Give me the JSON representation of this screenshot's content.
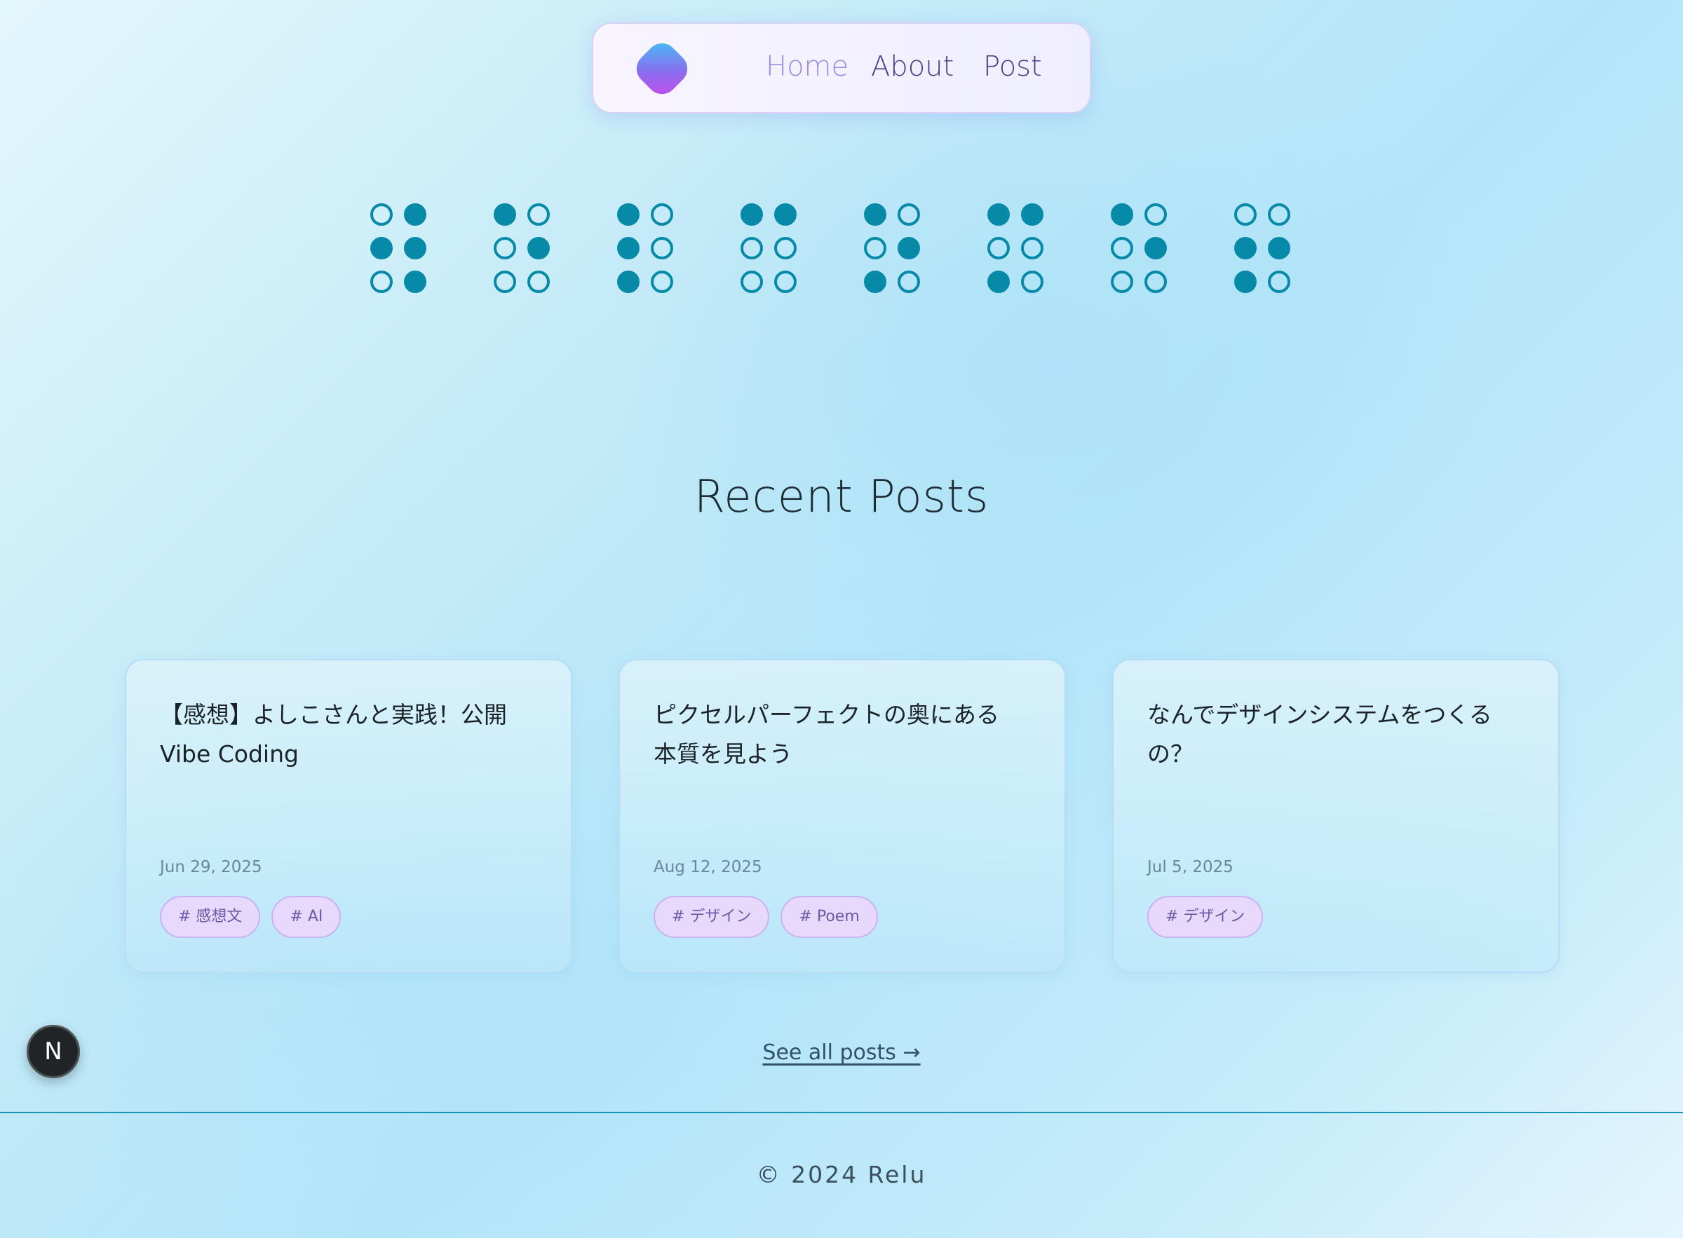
{
  "nav": {
    "logo_icon": "gradient-diamond-logo",
    "links": [
      {
        "label": "Home",
        "active": true
      },
      {
        "label": "About",
        "active": false
      },
      {
        "label": "Post",
        "active": false
      }
    ]
  },
  "braille": {
    "color": "#0789a8",
    "cells": [
      [
        0,
        1,
        1,
        1,
        0,
        1
      ],
      [
        1,
        0,
        0,
        1,
        0,
        0
      ],
      [
        1,
        0,
        1,
        0,
        1,
        0
      ],
      [
        1,
        1,
        0,
        0,
        0,
        0
      ],
      [
        1,
        0,
        0,
        1,
        1,
        0
      ],
      [
        1,
        1,
        0,
        0,
        1,
        0
      ],
      [
        1,
        0,
        0,
        1,
        0,
        0
      ],
      [
        0,
        0,
        1,
        1,
        1,
        0
      ]
    ]
  },
  "section": {
    "title": "Recent Posts"
  },
  "posts": [
    {
      "title": "【感想】よしこさんと実践！公開Vibe Coding",
      "date": "Jun 29, 2025",
      "tags": [
        "# 感想文",
        "# AI"
      ]
    },
    {
      "title": "ピクセルパーフェクトの奥にある本質を見よう",
      "date": "Aug 12, 2025",
      "tags": [
        "# デザイン",
        "# Poem"
      ]
    },
    {
      "title": "なんでデザインシステムをつくるの？",
      "date": "Jul 5, 2025",
      "tags": [
        "# デザイン"
      ]
    }
  ],
  "see_all": {
    "label": "See all posts →"
  },
  "footer": {
    "text": "© 2024 Relu"
  },
  "badge": {
    "label": "N"
  },
  "colors": {
    "accent": "#9f8ae6",
    "tag_bg": "#e6d9fb",
    "line": "#1694b3"
  }
}
